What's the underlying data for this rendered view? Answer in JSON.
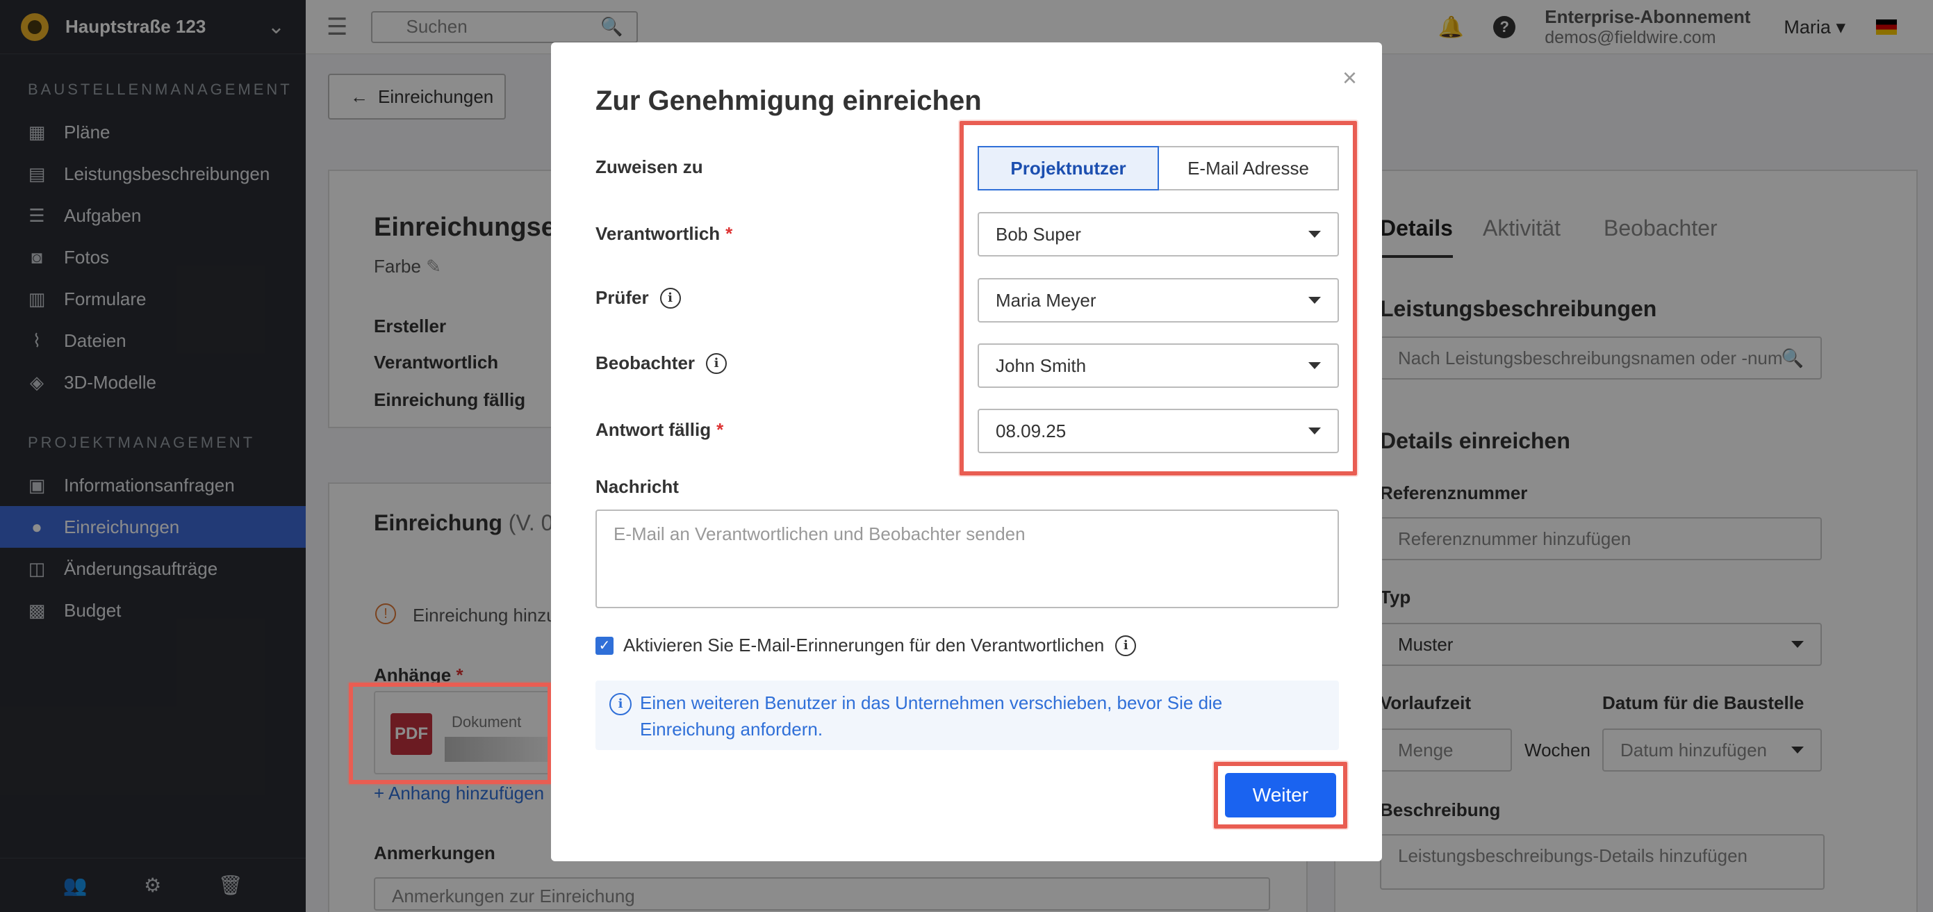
{
  "sidebar": {
    "project_name": "Hauptstraße 123",
    "section1": "BAUSTELLENMANAGEMENT",
    "section2": "PROJEKTMANAGEMENT",
    "items1": [
      {
        "label": "Pläne",
        "icon": "plans-icon"
      },
      {
        "label": "Leistungsbeschreibungen",
        "icon": "specs-icon"
      },
      {
        "label": "Aufgaben",
        "icon": "tasks-icon"
      },
      {
        "label": "Fotos",
        "icon": "camera-icon"
      },
      {
        "label": "Formulare",
        "icon": "forms-icon"
      },
      {
        "label": "Dateien",
        "icon": "paperclip-icon"
      },
      {
        "label": "3D-Modelle",
        "icon": "cube-icon"
      }
    ],
    "items2": [
      {
        "label": "Informationsanfragen",
        "icon": "rfi-icon"
      },
      {
        "label": "Einreichungen",
        "icon": "submittal-icon"
      },
      {
        "label": "Änderungsaufträge",
        "icon": "change-order-icon"
      },
      {
        "label": "Budget",
        "icon": "calculator-icon"
      }
    ]
  },
  "topbar": {
    "search_placeholder": "Suchen",
    "plan_name": "Enterprise-Abonnement",
    "email": "demos@fieldwire.com",
    "user": "Maria"
  },
  "page": {
    "back_label": "Einreichungen",
    "title": "Einreichungse",
    "color_label": "Farbe",
    "creator_label": "Ersteller",
    "responsible_label": "Verantwortlich",
    "due_label": "Einreichung fällig",
    "submission_title": "Einreichung",
    "submission_version": "(V. 0)",
    "warning": "Einreichung hinzu",
    "attachments_label": "Anhänge",
    "attachment_name": "Dokument",
    "pdf_label": "PDF",
    "add_attachment": "+ Anhang hinzufügen",
    "notes_label": "Anmerkungen",
    "notes_placeholder": "Anmerkungen zur Einreichung"
  },
  "right_panel": {
    "tabs": [
      "Details",
      "Aktivität",
      "Beobachter"
    ],
    "specs_heading": "Leistungsbeschreibungen",
    "specs_search_placeholder": "Nach Leistungsbeschreibungsnamen oder -numm",
    "details_heading": "Details einreichen",
    "ref_label": "Referenznummer",
    "ref_placeholder": "Referenznummer hinzufügen",
    "type_label": "Typ",
    "type_value": "Muster",
    "lead_label": "Vorlaufzeit",
    "lead_placeholder": "Menge",
    "weeks": "Wochen",
    "site_date_label": "Datum für die Baustelle",
    "site_date_placeholder": "Datum hinzufügen",
    "desc_label": "Beschreibung",
    "desc_placeholder": "Leistungsbeschreibungs-Details hinzufügen"
  },
  "modal": {
    "title": "Zur Genehmigung einreichen",
    "close_label": "×",
    "assign_label": "Zuweisen zu",
    "assign_options": [
      "Projektnutzer",
      "E-Mail Adresse"
    ],
    "responsible_label": "Verantwortlich",
    "responsible_value": "Bob Super",
    "reviewer_label": "Prüfer",
    "reviewer_value": "Maria Meyer",
    "watcher_label": "Beobachter",
    "watcher_value": "John Smith",
    "due_label": "Antwort fällig",
    "due_value": "08.09.25",
    "message_label": "Nachricht",
    "message_placeholder": "E-Mail an Verantwortlichen und Beobachter senden",
    "reminder_label": "Aktivieren Sie E-Mail-Erinnerungen für den Verantwortlichen",
    "note": "Einen weiteren Benutzer in das Unternehmen verschieben, bevor Sie die Einreichung anfordern.",
    "next_label": "Weiter",
    "required_mark": "*"
  },
  "colors": {
    "accent": "#1a63f0",
    "highlight": "#e95d52",
    "sidebar_bg": "#2b2d33",
    "sidebar_active": "#3f6ad8"
  }
}
